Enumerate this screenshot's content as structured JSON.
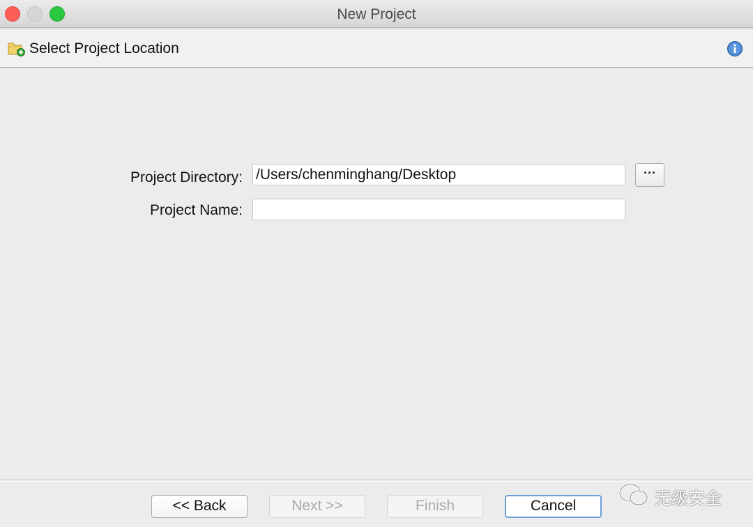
{
  "window": {
    "title": "New Project"
  },
  "header": {
    "title": "Select Project Location",
    "icon": "folder-add-icon",
    "info_icon": "info-icon"
  },
  "form": {
    "directory_label": "Project Directory:",
    "directory_value": "/Users/chenminghang/Desktop",
    "name_label": "Project Name:",
    "name_value": "",
    "browse_label": "···"
  },
  "buttons": {
    "back": "<< Back",
    "next": "Next >>",
    "finish": "Finish",
    "cancel": "Cancel"
  },
  "watermark": {
    "text": "无级安全"
  },
  "colors": {
    "accent": "#6a9fd8",
    "close": "#fd5e56",
    "zoom": "#2ac840"
  }
}
